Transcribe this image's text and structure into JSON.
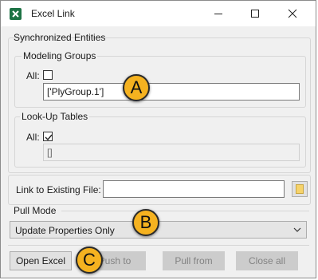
{
  "window": {
    "title": "Excel Link"
  },
  "synchronized_entities": {
    "label": "Synchronized Entities",
    "modeling_groups": {
      "label": "Modeling Groups",
      "all_label": "All:",
      "all_checked": false,
      "value": "['PlyGroup.1']"
    },
    "lookup_tables": {
      "label": "Look-Up Tables",
      "all_label": "All:",
      "all_checked": true,
      "value": "[]"
    }
  },
  "link_file": {
    "label": "Link to Existing File:",
    "value": ""
  },
  "pull_mode": {
    "label": "Pull Mode",
    "selected": "Update Properties Only"
  },
  "buttons": {
    "open_excel": "Open Excel",
    "push_to": "Push to",
    "pull_from": "Pull from",
    "close_all": "Close all"
  },
  "callouts": {
    "a": "A",
    "b": "B",
    "c": "C"
  },
  "colors": {
    "callout": "#f5b220",
    "excel_icon": "#1d7345"
  }
}
